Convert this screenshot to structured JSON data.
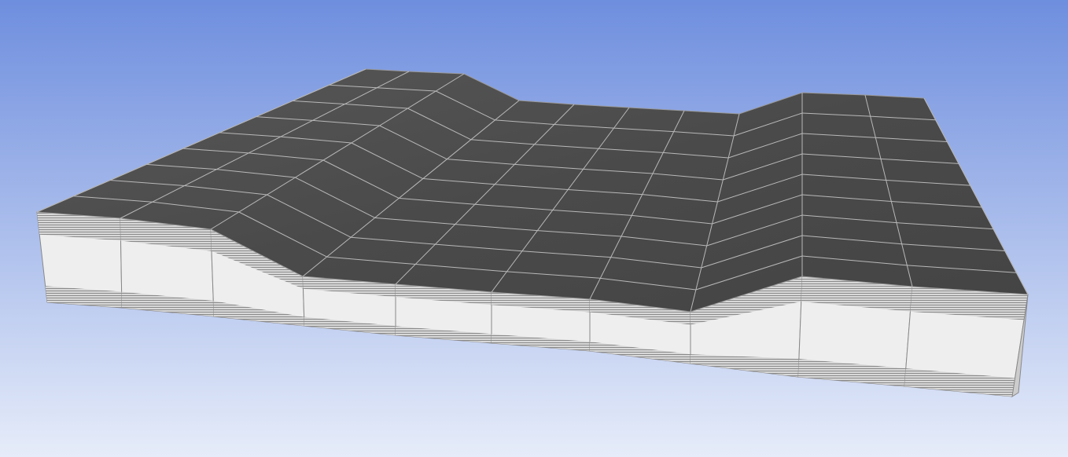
{
  "viewport": {
    "background_top": "#6e8ede",
    "background_bottom": "#e6ecf9",
    "surface_color": "#4d4d4d",
    "mesh_line_color": "#b8b8b8",
    "side_face_color": "#eeeeee",
    "inflation_band_color": "#a8a8a8"
  }
}
